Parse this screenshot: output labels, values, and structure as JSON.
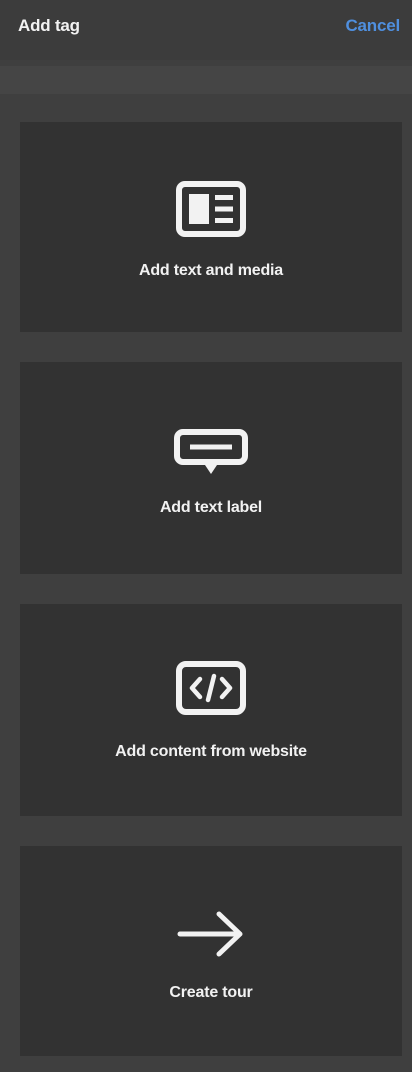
{
  "header": {
    "title": "Add tag",
    "cancel_label": "Cancel"
  },
  "options": [
    {
      "label": "Add text and media",
      "icon": "text-media-icon"
    },
    {
      "label": "Add text label",
      "icon": "text-label-icon"
    },
    {
      "label": "Add content from website",
      "icon": "code-icon"
    },
    {
      "label": "Create tour",
      "icon": "arrow-right-icon"
    }
  ],
  "colors": {
    "panel": "#3f3f3f",
    "card": "#323232",
    "text": "#f2f2f2",
    "accent": "#4f8fde"
  }
}
